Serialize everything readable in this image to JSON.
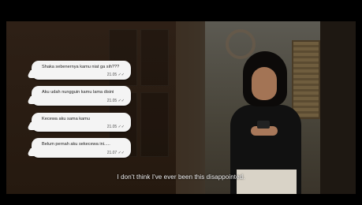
{
  "chat": {
    "messages": [
      {
        "text": "Shaka sebenernya kamu niat ga sih???",
        "time": "21.05",
        "ticks": "✓✓"
      },
      {
        "text": "Aku udah nungguin kamu lama disini",
        "time": "21.05",
        "ticks": "✓✓"
      },
      {
        "text": "Kecewa aku sama kamu",
        "time": "21.05",
        "ticks": "✓✓"
      },
      {
        "text": "Belum pernah aku sekecewa ini.....",
        "time": "21.07",
        "ticks": "✓✓"
      }
    ]
  },
  "subtitle": "I don't think I've ever been this disappointed."
}
